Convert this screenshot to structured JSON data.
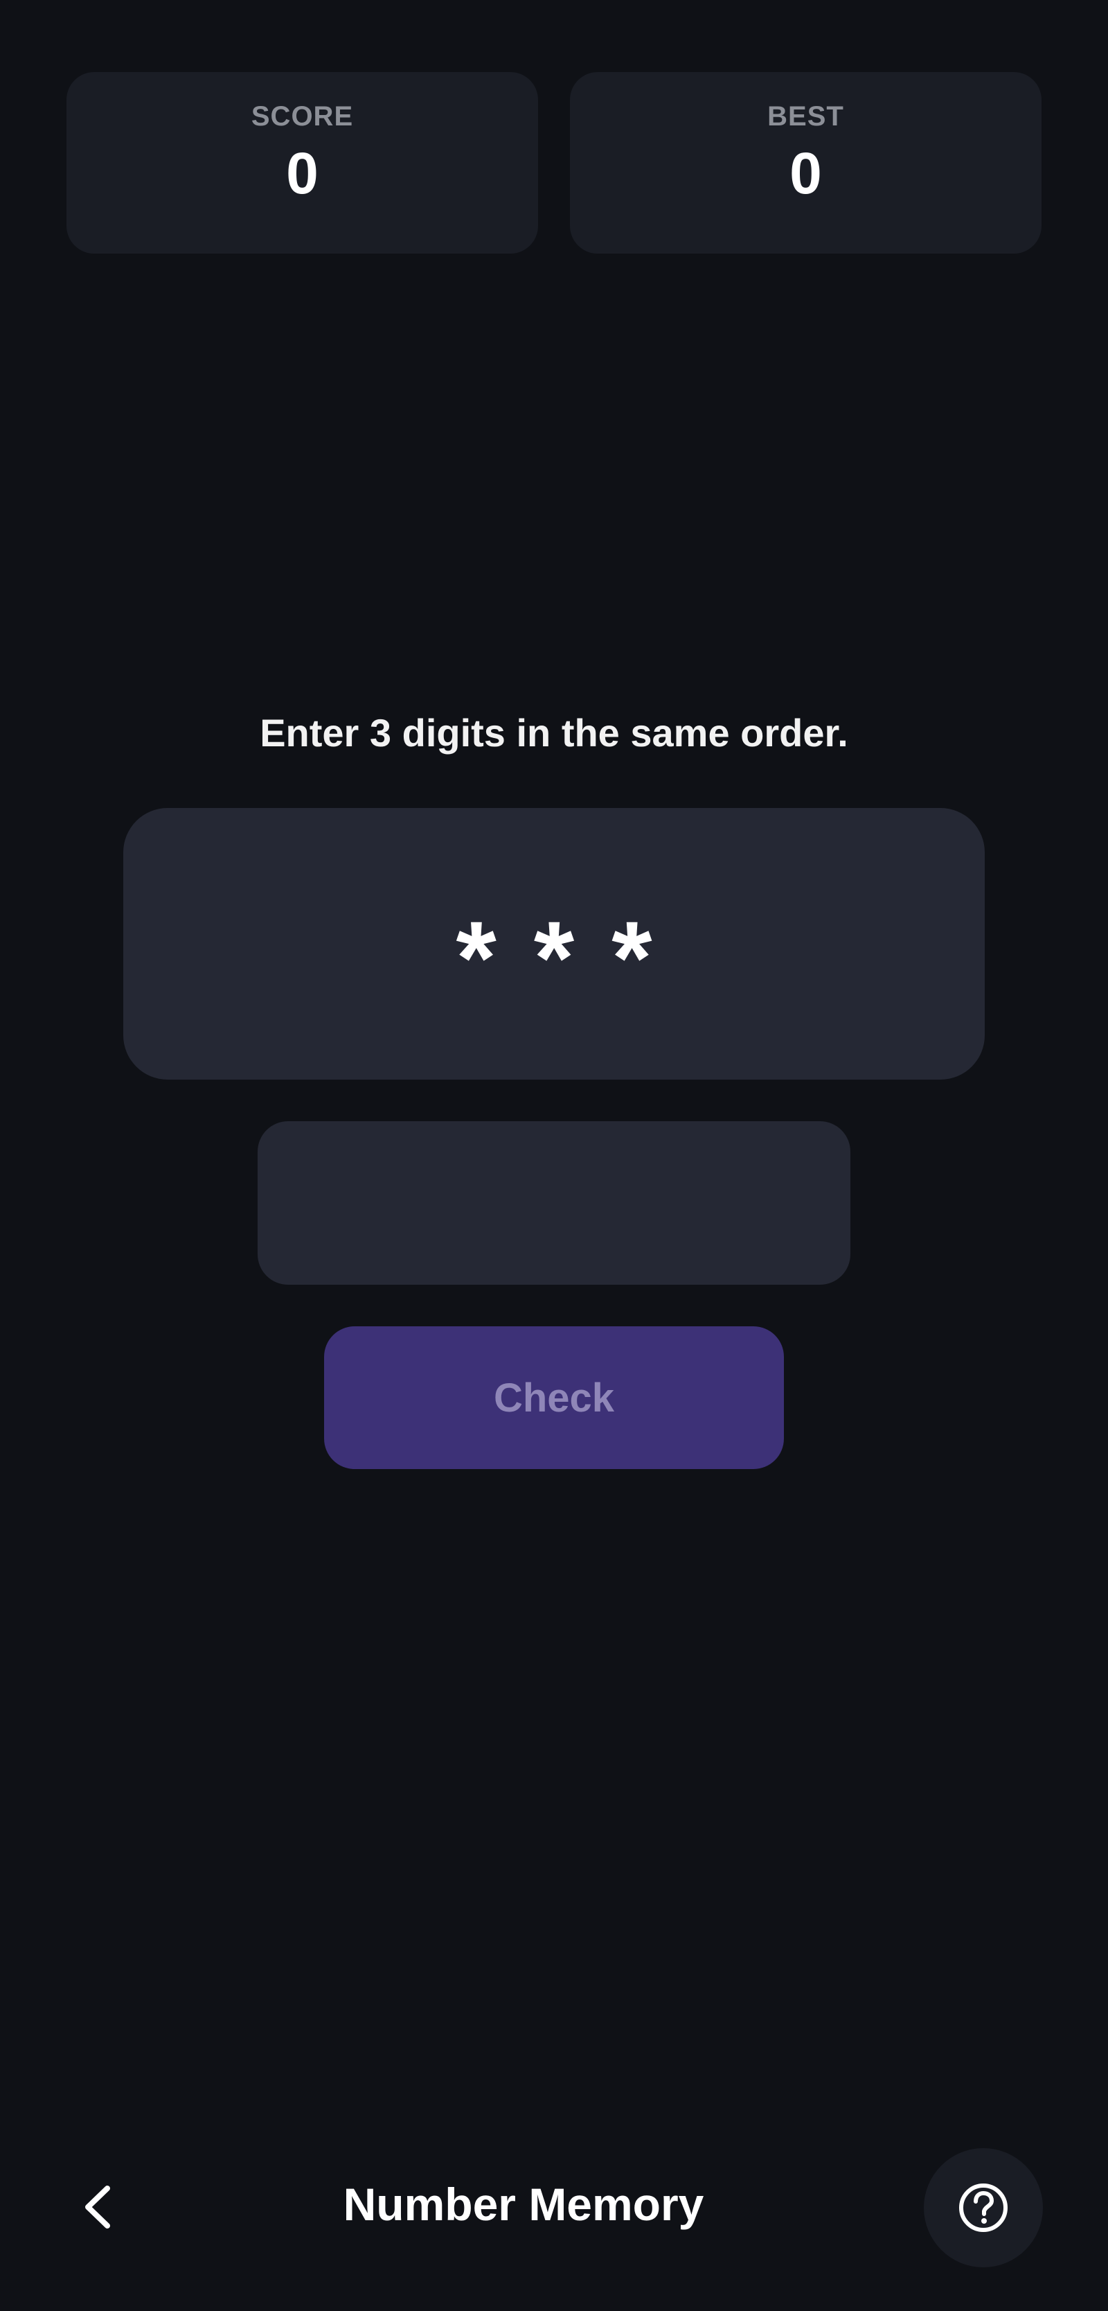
{
  "scores": {
    "score_label": "SCORE",
    "score_value": "0",
    "best_label": "BEST",
    "best_value": "0"
  },
  "game": {
    "instruction": "Enter 3 digits in the same order.",
    "masked_digits": "***",
    "answer_value": "",
    "answer_placeholder": "",
    "check_label": "Check"
  },
  "bottom_bar": {
    "title": "Number Memory",
    "back_icon": "chevron-left-icon",
    "help_icon": "question-circle-icon"
  },
  "colors": {
    "background": "#0f1116",
    "card": "#1a1d25",
    "display": "#252834",
    "check_button": "#3d3177",
    "check_text": "#8f86b8"
  }
}
